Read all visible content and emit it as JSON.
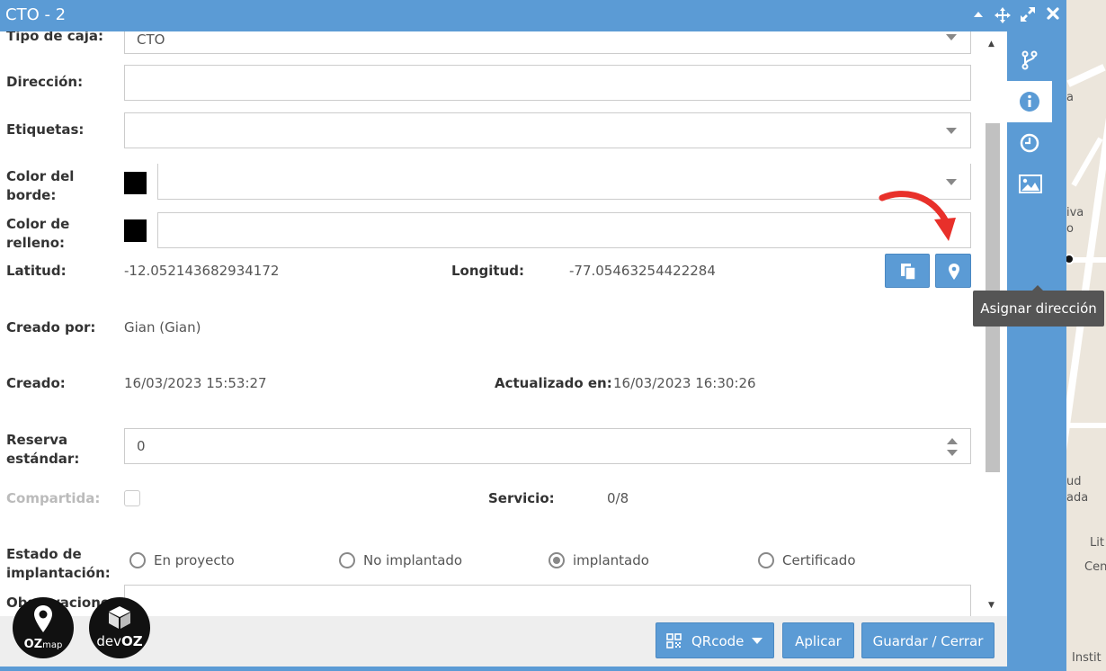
{
  "window": {
    "title": "CTO - 2"
  },
  "form": {
    "tipo_caja": {
      "label": "Tipo de caja:",
      "value": "CTO"
    },
    "direccion": {
      "label": "Dirección:",
      "value": ""
    },
    "etiquetas": {
      "label": "Etiquetas:",
      "value": ""
    },
    "color_borde": {
      "label_line1": "Color del",
      "label_line2": "borde:",
      "swatch": "#000000"
    },
    "color_relleno": {
      "label_line1": "Color de",
      "label_line2": "relleno:",
      "swatch": "#000000"
    },
    "latitud": {
      "label": "Latitud:",
      "value": "-12.052143682934172"
    },
    "longitud": {
      "label": "Longitud:",
      "value": "-77.05463254422284"
    },
    "creado_por": {
      "label": "Creado por:",
      "value": "Gian (Gian)"
    },
    "creado": {
      "label": "Creado:",
      "value": "16/03/2023 15:53:27"
    },
    "actualizado": {
      "label": "Actualizado en:",
      "value": "16/03/2023 16:30:26"
    },
    "reserva": {
      "label_line1": "Reserva",
      "label_line2": "estándar:",
      "value": "0"
    },
    "compartida": {
      "label": "Compartida:",
      "checked": false
    },
    "servicio": {
      "label": "Servicio:",
      "value": "0/8"
    },
    "estado": {
      "label_line1": "Estado de",
      "label_line2": "implantación:",
      "options": [
        "En proyecto",
        "No implantado",
        "implantado",
        "Certificado"
      ],
      "selected": "implantado"
    },
    "observaciones": {
      "label": "Observaciones"
    }
  },
  "tooltip": {
    "text": "Asignar dirección"
  },
  "footer": {
    "qrcode_label": "QRcode",
    "apply_label": "Aplicar",
    "save_close_label": "Guardar / Cerrar"
  },
  "logos": {
    "ozmap_a": "OZ",
    "ozmap_b": "map",
    "devoz_a": "dev",
    "devoz_b": "OZ"
  },
  "map": {
    "labels": [
      "a",
      "iva",
      "o",
      "ud",
      "ada",
      "Lit",
      "Cen",
      "Instit"
    ]
  },
  "colors": {
    "accent": "#5b9bd5",
    "annotation_arrow": "#e8302a"
  },
  "icons": [
    "minimize-icon",
    "move-icon",
    "expand-icon",
    "close-icon",
    "branch-icon",
    "info-icon",
    "clock-icon",
    "image-icon",
    "copy-icon",
    "map-pin-icon",
    "qrcode-icon",
    "caret-down-icon"
  ]
}
